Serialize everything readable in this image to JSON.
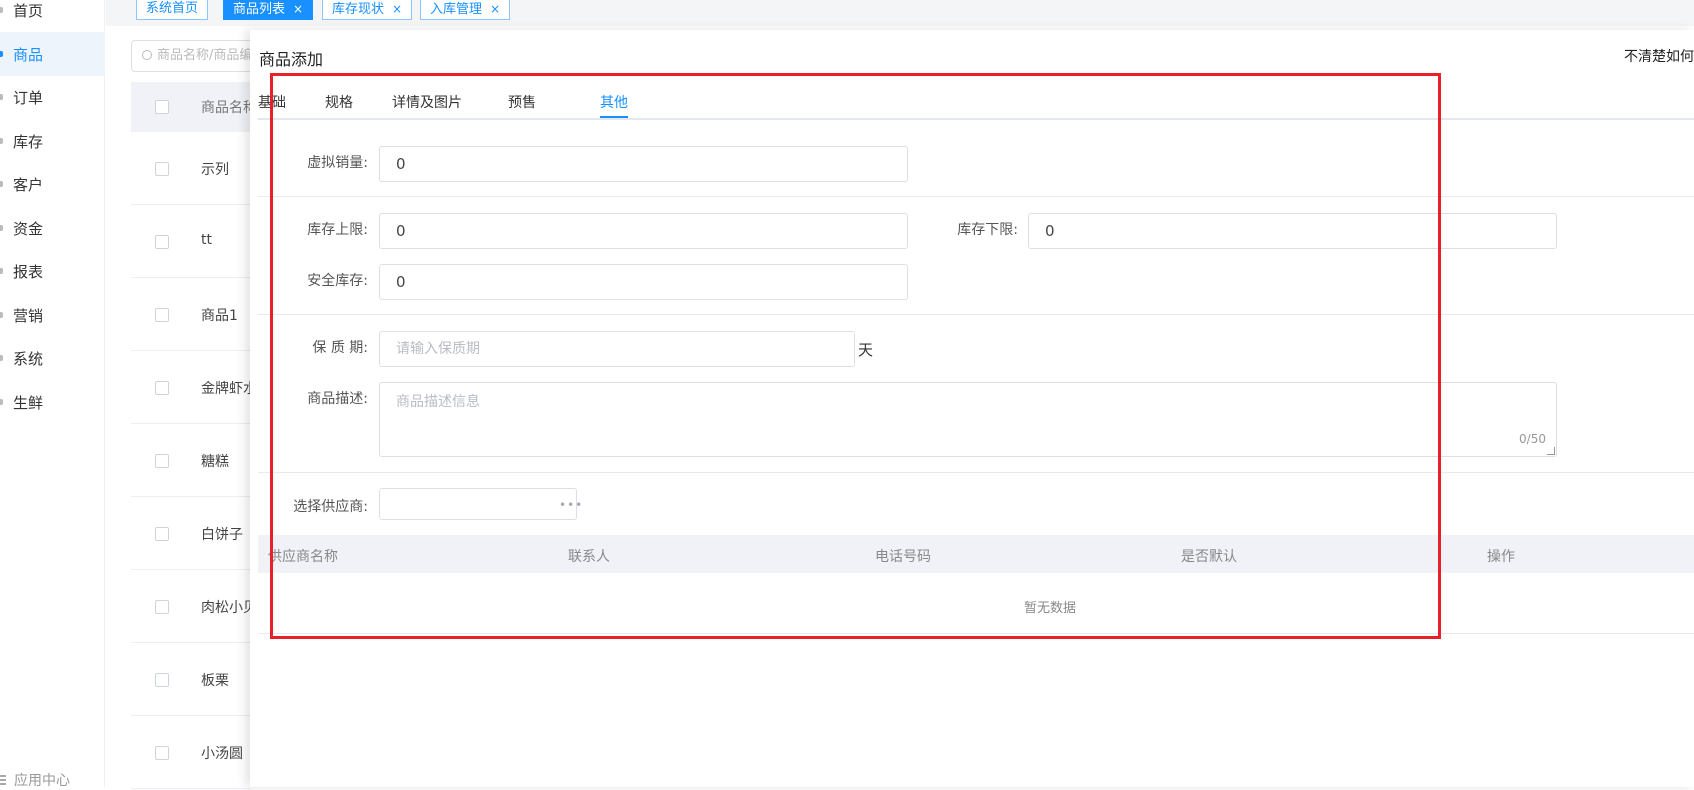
{
  "sidebar": {
    "items": [
      {
        "label": "首页"
      },
      {
        "label": "商品"
      },
      {
        "label": "订单"
      },
      {
        "label": "库存"
      },
      {
        "label": "客户"
      },
      {
        "label": "资金"
      },
      {
        "label": "报表"
      },
      {
        "label": "营销"
      },
      {
        "label": "系统"
      },
      {
        "label": "生鲜"
      }
    ],
    "active_index": 1,
    "bottom_label": "应用中心"
  },
  "tabs": [
    {
      "label": "系统首页",
      "closable": false,
      "active": false
    },
    {
      "label": "商品列表",
      "closable": true,
      "active": true
    },
    {
      "label": "库存现状",
      "closable": true,
      "active": false
    },
    {
      "label": "入库管理",
      "closable": true,
      "active": false
    }
  ],
  "tab_close_glyph": "×",
  "background_list": {
    "search_placeholder": "商品名称/商品编",
    "column_header": "商品名称",
    "rows": [
      "示列",
      "tt",
      "商品1",
      "金牌虾水饺",
      "糖糕",
      "白饼子",
      "肉松小贝",
      "板栗",
      "小汤圆"
    ]
  },
  "drawer": {
    "title": "商品添加",
    "help_text": "不清楚如何",
    "form_tabs": [
      "基础",
      "规格",
      "详情及图片",
      "预售",
      "其他"
    ],
    "active_form_tab": 4,
    "fields": {
      "virtual_sales": {
        "label": "虚拟销量:",
        "value": "0"
      },
      "stock_upper": {
        "label": "库存上限:",
        "value": "0"
      },
      "stock_lower": {
        "label": "库存下限:",
        "value": "0"
      },
      "safety_stock": {
        "label": "安全库存:",
        "value": "0"
      },
      "shelf_life": {
        "label": "保 质 期:",
        "placeholder": "请输入保质期",
        "unit": "天"
      },
      "description": {
        "label": "商品描述:",
        "placeholder": "商品描述信息",
        "counter": "0/50"
      },
      "supplier_select": {
        "label": "选择供应商:",
        "value": ""
      }
    },
    "supplier_table": {
      "columns": [
        "供应商名称",
        "联系人",
        "电话号码",
        "是否默认",
        "操作"
      ],
      "empty_text": "暂无数据"
    }
  },
  "colors": {
    "accent": "#1890ff",
    "highlight_box": "#e8202a"
  }
}
